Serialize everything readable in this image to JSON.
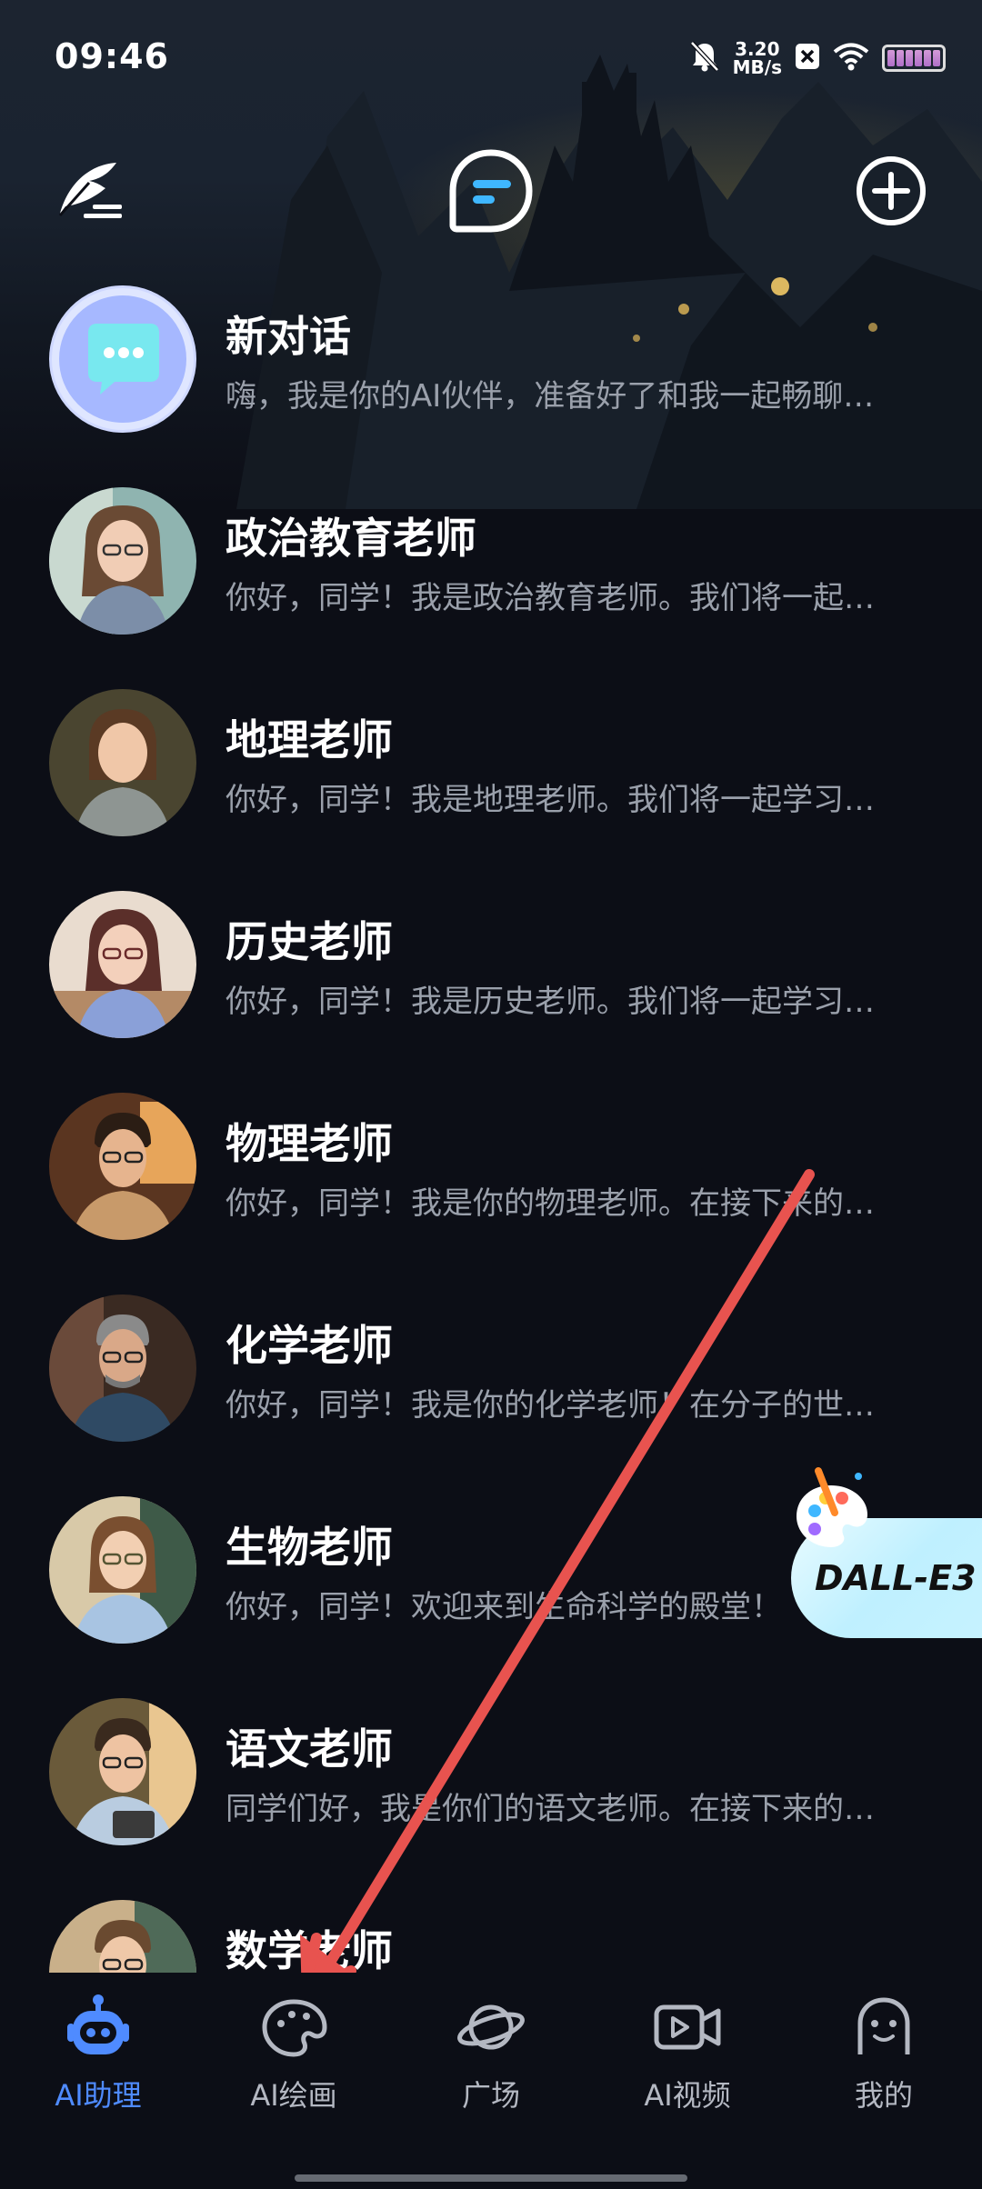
{
  "status_bar": {
    "time": "09:46",
    "speed_value": "3.20",
    "speed_unit": "MB/s",
    "icons": [
      "mute-bell-icon",
      "speed-indicator",
      "x-app-icon",
      "wifi-icon",
      "battery-icon"
    ]
  },
  "top_bar": {
    "left_icon": "feather-quill-icon",
    "center_icon": "app-logo-icon",
    "right_icon": "add-circle-icon"
  },
  "chats": [
    {
      "name": "新对话",
      "preview": "嗨，我是你的AI伙伴，准备好了和我一起畅聊…",
      "avatar": "chat-bubble-icon"
    },
    {
      "name": "政治教育老师",
      "preview": "你好，同学！我是政治教育老师。我们将一起…",
      "avatar": "teacher-avatar"
    },
    {
      "name": "地理老师",
      "preview": "你好，同学！我是地理老师。我们将一起学习…",
      "avatar": "teacher-avatar"
    },
    {
      "name": "历史老师",
      "preview": "你好，同学！我是历史老师。我们将一起学习…",
      "avatar": "teacher-avatar"
    },
    {
      "name": "物理老师",
      "preview": "你好，同学！我是你的物理老师。在接下来的…",
      "avatar": "teacher-avatar"
    },
    {
      "name": "化学老师",
      "preview": "你好，同学！我是你的化学老师！在分子的世…",
      "avatar": "teacher-avatar"
    },
    {
      "name": "生物老师",
      "preview": "你好，同学！欢迎来到生命科学的殿堂！",
      "avatar": "teacher-avatar"
    },
    {
      "name": "语文老师",
      "preview": "同学们好，我是你们的语文老师。在接下来的…",
      "avatar": "teacher-avatar"
    },
    {
      "name": "数学老师",
      "preview": "",
      "avatar": "teacher-avatar"
    }
  ],
  "dalle_badge": {
    "label": "DALL-E3"
  },
  "bottom_nav": [
    {
      "label": "AI助理",
      "icon": "robot-icon",
      "active": true
    },
    {
      "label": "AI绘画",
      "icon": "palette-icon",
      "active": false
    },
    {
      "label": "广场",
      "icon": "planet-icon",
      "active": false
    },
    {
      "label": "AI视频",
      "icon": "video-play-icon",
      "active": false
    },
    {
      "label": "我的",
      "icon": "profile-face-icon",
      "active": false
    }
  ],
  "colors": {
    "background": "#0c0e16",
    "accent": "#4f8bff",
    "annotation_arrow": "#e8534f",
    "preview_text": "#9aa0ab"
  }
}
